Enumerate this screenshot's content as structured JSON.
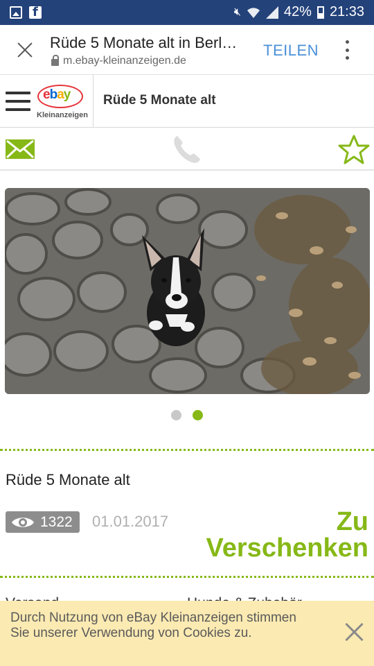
{
  "status_bar": {
    "battery": "42%",
    "time": "21:33",
    "left_icons": [
      "gallery-icon",
      "facebook-icon"
    ],
    "right_icons": [
      "mute-icon",
      "wifi-icon",
      "signal-icon",
      "battery-icon"
    ]
  },
  "browser": {
    "title": "Rüde 5 Monate alt in Berl…",
    "url": "m.ebay-kleinanzeigen.de",
    "share_label": "TEILEN",
    "accent": "#4a90d9"
  },
  "site": {
    "logo_letters": [
      "e",
      "b",
      "a",
      "y"
    ],
    "logo_colors": [
      "#e53238",
      "#0064d2",
      "#f5af02",
      "#86b817"
    ],
    "logo_sub": "Kleinanzeigen",
    "page_title": "Rüde 5 Monate alt"
  },
  "actions": {
    "icons": [
      "mail-icon",
      "phone-icon",
      "star-icon"
    ],
    "accent": "#86b817"
  },
  "gallery": {
    "count": 2,
    "active_index": 1
  },
  "ad": {
    "title": "Rüde 5 Monate alt",
    "views": "1322",
    "date": "01.01.2017",
    "price_line1": "Zu",
    "price_line2": "Verschenken",
    "peek_left": "Versand",
    "peek_right": "Hunde & Zubehör"
  },
  "cookie": {
    "text": "Durch Nutzung von eBay Kleinanzeigen stimmen Sie unserer Verwendung von Cookies zu.",
    "background": "#fbeab2"
  }
}
